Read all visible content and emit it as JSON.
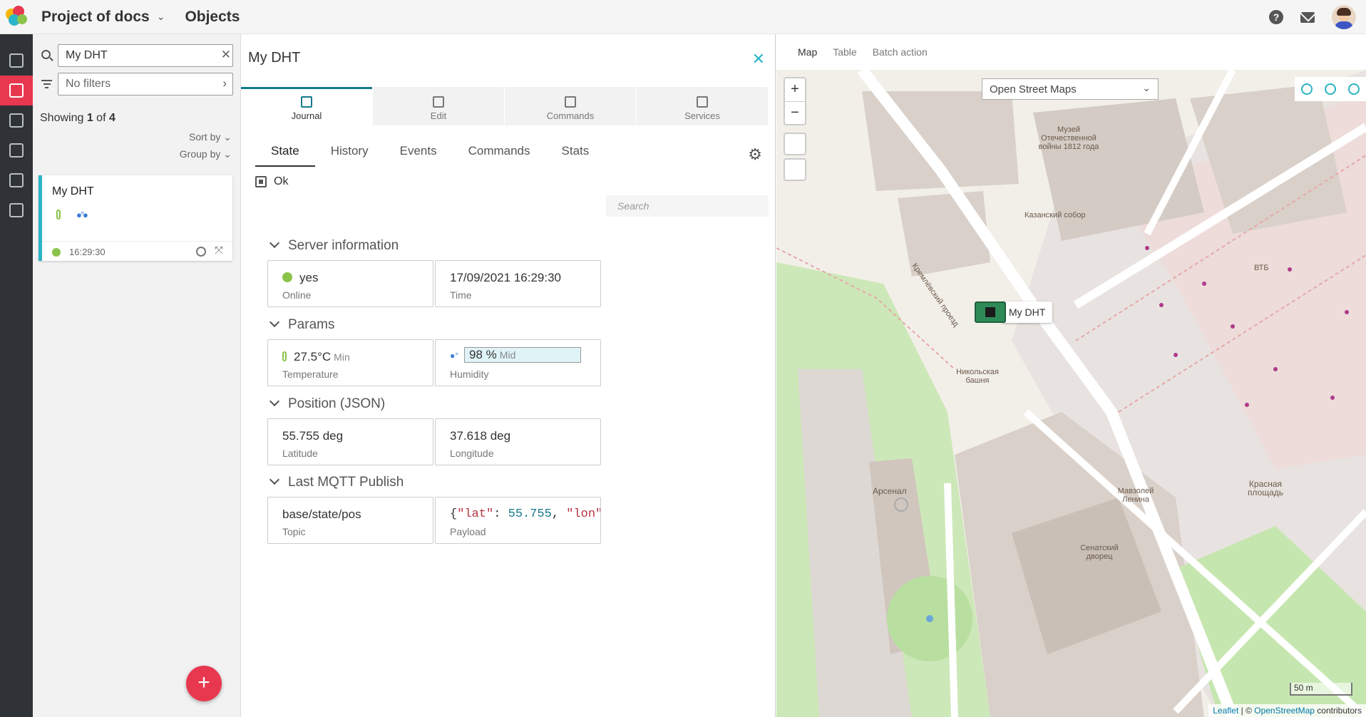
{
  "header": {
    "project": "Project of docs",
    "section": "Objects"
  },
  "colors": {
    "accent": "#e8384f",
    "teal": "#2bb4c5",
    "online": "#8bc34a"
  },
  "sidebar": {
    "search_value": "My DHT",
    "filter_placeholder": "No filters",
    "showing_prefix": "Showing ",
    "showing_current": "1",
    "showing_sep": " of ",
    "showing_total": "4",
    "sort_by": "Sort by",
    "group_by": "Group by",
    "card": {
      "name": "My DHT",
      "time": "16:29:30"
    }
  },
  "detail": {
    "title": "My DHT",
    "main_tabs": [
      "Journal",
      "Edit",
      "Commands",
      "Services"
    ],
    "sub_tabs": [
      "State",
      "History",
      "Events",
      "Commands",
      "Stats"
    ],
    "status": "Ok",
    "search_placeholder": "Search",
    "sections": {
      "server": {
        "title": "Server information",
        "online_value": "yes",
        "online_label": "Online",
        "time_value": "17/09/2021 16:29:30",
        "time_label": "Time"
      },
      "params": {
        "title": "Params",
        "temp_value": "27.5°C",
        "temp_level": "Min",
        "temp_label": "Temperature",
        "hum_value": "98 %",
        "hum_level": "Mid",
        "hum_label": "Humidity"
      },
      "position": {
        "title": "Position (JSON)",
        "lat_value": "55.755 deg",
        "lat_label": "Latitude",
        "lon_value": "37.618 deg",
        "lon_label": "Longitude"
      },
      "mqtt": {
        "title": "Last MQTT Publish",
        "topic_value": "base/state/pos",
        "topic_label": "Topic",
        "payload_open": "{",
        "payload_k1": "\"lat\"",
        "payload_colon": ": ",
        "payload_v1": "55.755",
        "payload_comma": ", ",
        "payload_k2": "\"lon\"",
        "payload_label": "Payload"
      }
    }
  },
  "map": {
    "tabs": [
      "Map",
      "Table",
      "Batch action"
    ],
    "layer": "Open Street Maps",
    "marker_label": "My DHT",
    "scale": "50 m",
    "attr_leaflet": "Leaflet",
    "attr_sep": " | © ",
    "attr_osm": "OpenStreetMap",
    "attr_tail": " contributors",
    "labels": {
      "kazan": "Казанский собор",
      "kremlin": "Кремлёвский проезд",
      "arsenal": "Арсенал",
      "red_square": "Красная площадь",
      "senate": "Сенатский дворец",
      "nikolskaya": "Никольская башня",
      "mausoleum": "Мавзолей Ленина",
      "vtb": "ВТБ",
      "museum": "Музей Отечественной войны 1812 года"
    }
  }
}
